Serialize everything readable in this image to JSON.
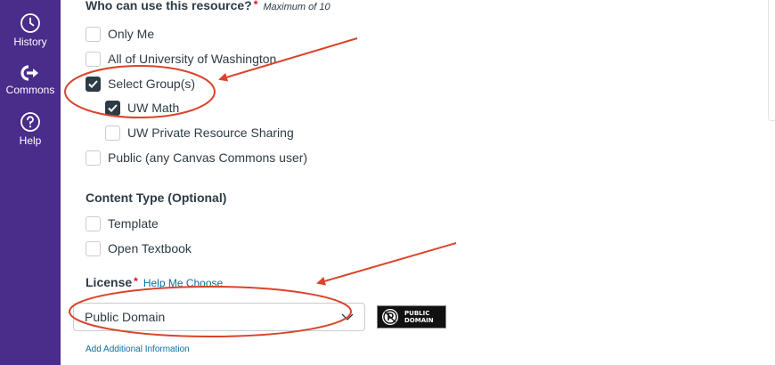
{
  "nav": {
    "history_label": "History",
    "commons_label": "Commons",
    "help_label": "Help"
  },
  "audience": {
    "title": "Who can use this resource?",
    "required_mark": "*",
    "hint": "Maximum of 10",
    "options": [
      {
        "label": "Only Me",
        "checked": false
      },
      {
        "label": "All of University of Washington",
        "checked": false
      },
      {
        "label": "Select Group(s)",
        "checked": true
      },
      {
        "label": "UW Math",
        "checked": true
      },
      {
        "label": "UW Private Resource Sharing",
        "checked": false
      },
      {
        "label": "Public (any Canvas Commons user)",
        "checked": false
      }
    ]
  },
  "content_type": {
    "title": "Content Type (Optional)",
    "options": [
      {
        "label": "Template",
        "checked": false
      },
      {
        "label": "Open Textbook",
        "checked": false
      }
    ]
  },
  "license": {
    "title": "License",
    "required_mark": "*",
    "help_link": "Help Me Choose",
    "selected": "Public Domain",
    "badge_line1": "PUBLIC",
    "badge_line2": "DOMAIN"
  },
  "add_info_link": "Add Additional Information",
  "colors": {
    "nav_bg": "#4a2c8a",
    "link": "#0770a3",
    "annotation": "#d9442b",
    "checked": "#2d3b45"
  }
}
